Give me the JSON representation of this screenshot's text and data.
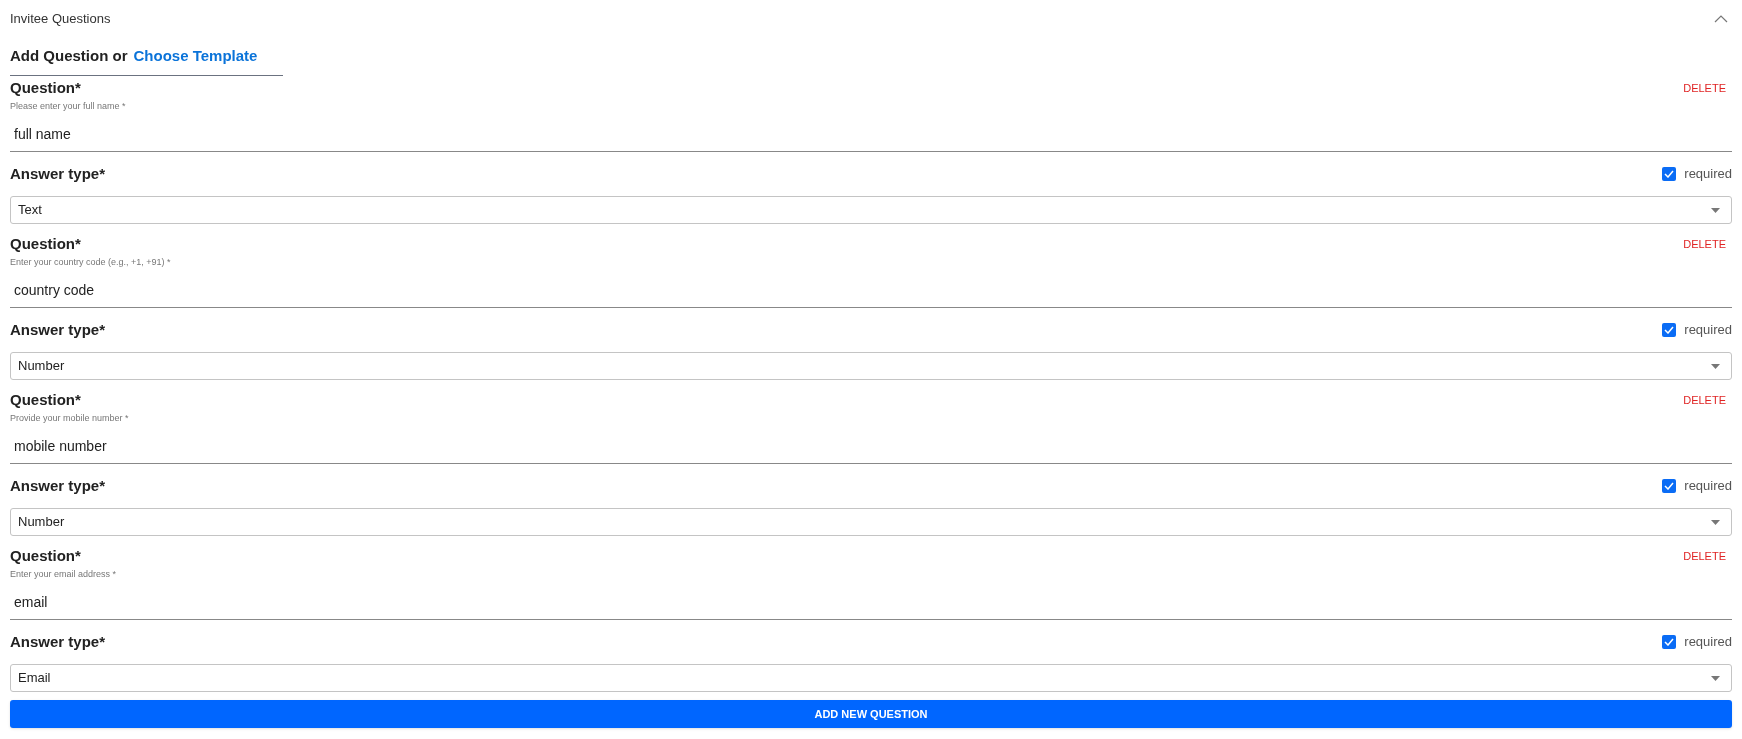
{
  "section": {
    "title": "Invitee Questions",
    "expanded": true
  },
  "add_row": {
    "label": "Add Question or",
    "link": "Choose Template"
  },
  "questions": [
    {
      "label": "Question*",
      "hint": "Please enter your full name *",
      "value": "full name",
      "delete": "DELETE",
      "answer_label": "Answer type*",
      "required": {
        "label": "required",
        "checked": true
      },
      "answer_type": "Text"
    },
    {
      "label": "Question*",
      "hint": "Enter your country code (e.g., +1, +91) *",
      "value": "country code",
      "delete": "DELETE",
      "answer_label": "Answer type*",
      "required": {
        "label": "required",
        "checked": true
      },
      "answer_type": "Number"
    },
    {
      "label": "Question*",
      "hint": "Provide your mobile number *",
      "value": "mobile number",
      "delete": "DELETE",
      "answer_label": "Answer type*",
      "required": {
        "label": "required",
        "checked": true
      },
      "answer_type": "Number"
    },
    {
      "label": "Question*",
      "hint": "Enter your email address *",
      "value": "email",
      "delete": "DELETE",
      "answer_label": "Answer type*",
      "required": {
        "label": "required",
        "checked": true
      },
      "answer_type": "Email"
    }
  ],
  "add_button": "ADD NEW QUESTION"
}
